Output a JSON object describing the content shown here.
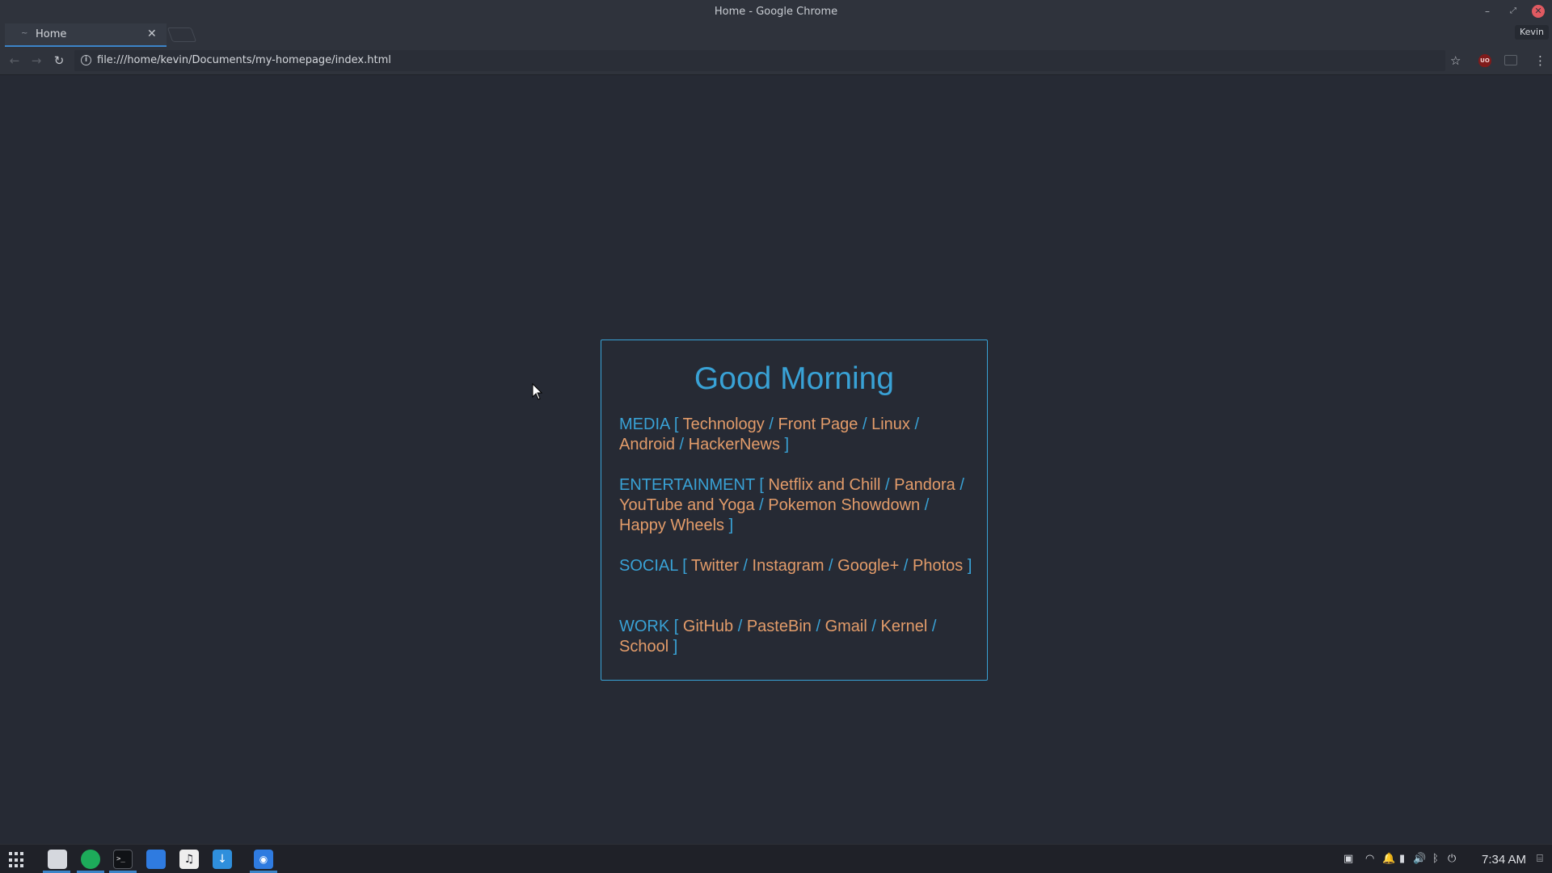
{
  "window": {
    "title": "Home - Google Chrome",
    "minimize_glyph": "–",
    "maximize_glyph": "⤢",
    "close_glyph": "✕"
  },
  "tab": {
    "title": "Home",
    "favicon": "~",
    "close": "✕"
  },
  "profile": {
    "name": "Kevin"
  },
  "toolbar": {
    "back": "←",
    "forward": "→",
    "reload": "↻",
    "url": "file:///home/kevin/Documents/my-homepage/index.html",
    "info": "i",
    "star": "☆",
    "ublock": "UO",
    "menu": "⋮"
  },
  "page": {
    "greeting": "Good Morning",
    "sections": [
      {
        "category": "MEDIA",
        "links": [
          "Technology",
          "Front Page",
          "Linux",
          "Android",
          "HackerNews"
        ]
      },
      {
        "category": "ENTERTAINMENT",
        "links": [
          "Netflix and Chill",
          "Pandora",
          "YouTube and Yoga",
          "Pokemon Showdown",
          "Happy Wheels"
        ]
      },
      {
        "category": "SOCIAL",
        "links": [
          "Twitter",
          "Instagram",
          "Google+",
          "Photos"
        ]
      },
      {
        "category": "WORK",
        "links": [
          "GitHub",
          "PasteBin",
          "Gmail",
          "Kernel",
          "School"
        ]
      }
    ],
    "open_bracket": "[",
    "close_bracket": "]",
    "separator": "/"
  },
  "taskbar": {
    "terminal_glyph": ">_",
    "music_glyph": "♫",
    "download_glyph": "↓",
    "screenshot_glyph": "◉",
    "tray": {
      "screenshot": "▣",
      "wifi": "◠",
      "notifications": "🔔",
      "battery": "▮",
      "volume": "🔊",
      "bluetooth": "ᛒ",
      "power": "⏻",
      "keyboard": "⌸"
    },
    "clock": "7:34 AM"
  },
  "colors": {
    "background": "#262a34",
    "accent_blue": "#39a2d6",
    "link_orange": "#e39c6a",
    "chrome_frame": "#2f333c",
    "taskbar": "#1f2128"
  }
}
